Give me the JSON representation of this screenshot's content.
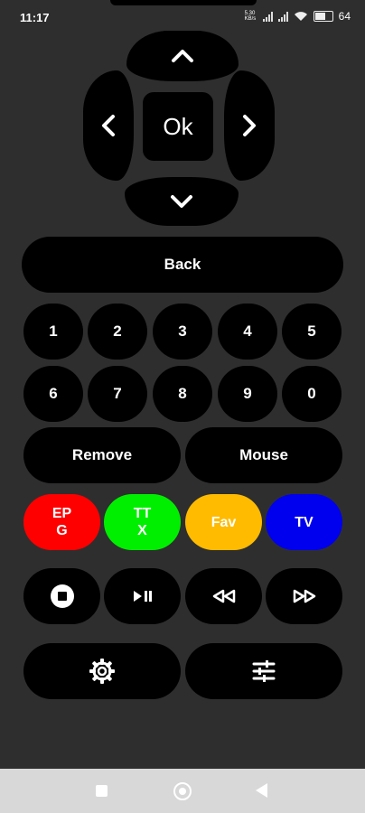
{
  "status_bar": {
    "time": "11:17",
    "network_speed": "5.30 KB/s",
    "battery": "64"
  },
  "dpad": {
    "up_icon": "chevron-up-icon",
    "down_icon": "chevron-down-icon",
    "left_icon": "chevron-left-icon",
    "right_icon": "chevron-right-icon",
    "ok_label": "Ok"
  },
  "back_label": "Back",
  "numbers": [
    "1",
    "2",
    "3",
    "4",
    "5",
    "6",
    "7",
    "8",
    "9",
    "0"
  ],
  "actions": {
    "remove_label": "Remove",
    "mouse_label": "Mouse"
  },
  "color_buttons": [
    {
      "label": "EP\nG",
      "color": "#ff0000"
    },
    {
      "label": "TT\nX",
      "color": "#00ee00"
    },
    {
      "label": "Fav",
      "color": "#ffbb00"
    },
    {
      "label": "TV",
      "color": "#0000ee"
    }
  ],
  "playback": {
    "stop_icon": "stop-icon",
    "play_pause_icon": "play-pause-icon",
    "rewind_icon": "rewind-icon",
    "fast_forward_icon": "fast-forward-icon"
  },
  "bottom": {
    "settings_icon": "gear-icon",
    "adjust_icon": "sliders-icon"
  },
  "nav_bar": {
    "recents_icon": "square-icon",
    "home_icon": "circle-icon",
    "back_icon": "triangle-back-icon"
  }
}
